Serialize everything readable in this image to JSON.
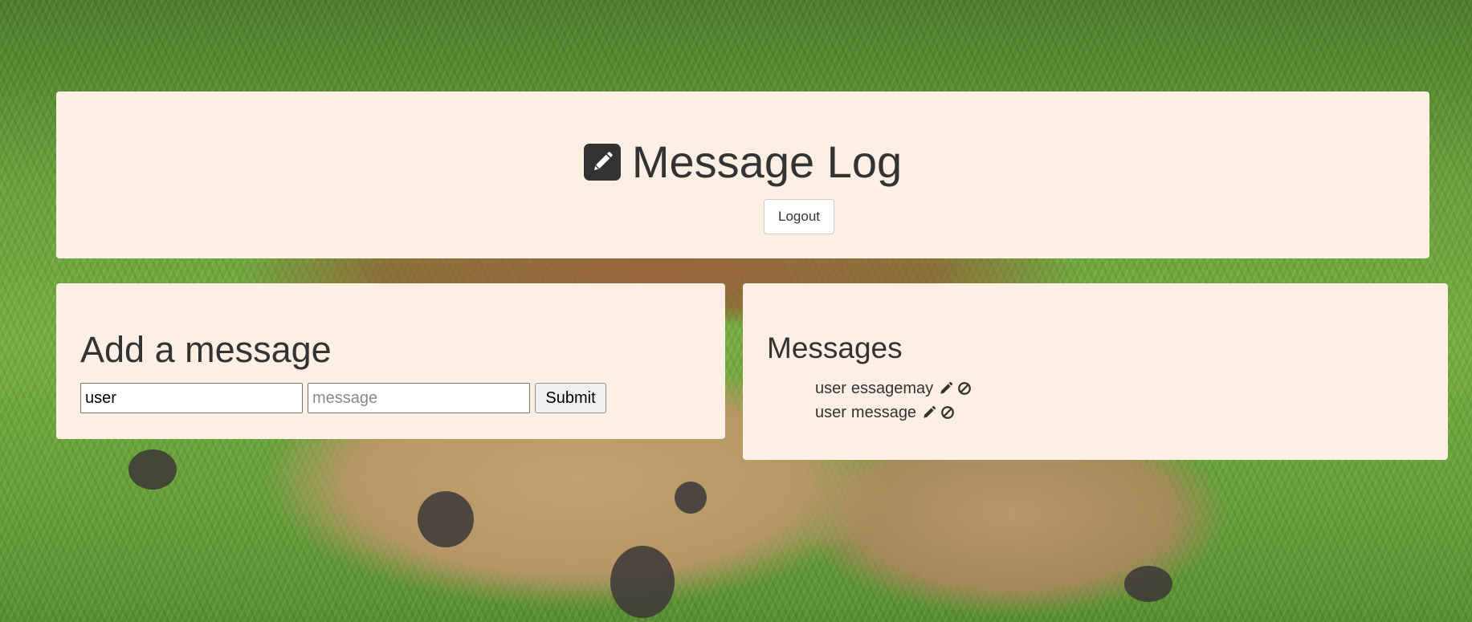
{
  "header": {
    "title": "Message Log",
    "title_icon": "pencil-square-icon",
    "logout_label": "Logout"
  },
  "add_message": {
    "title": "Add a message",
    "user_value": "user",
    "message_placeholder": "message",
    "submit_label": "Submit"
  },
  "messages": {
    "title": "Messages",
    "items": [
      {
        "user": "user",
        "text": "essagemay",
        "edit_icon": "pencil-icon",
        "delete_icon": "ban-icon"
      },
      {
        "user": "user",
        "text": "message",
        "edit_icon": "pencil-icon",
        "delete_icon": "ban-icon"
      }
    ]
  },
  "colors": {
    "card_background": "#fdefe4",
    "text": "#333333"
  }
}
